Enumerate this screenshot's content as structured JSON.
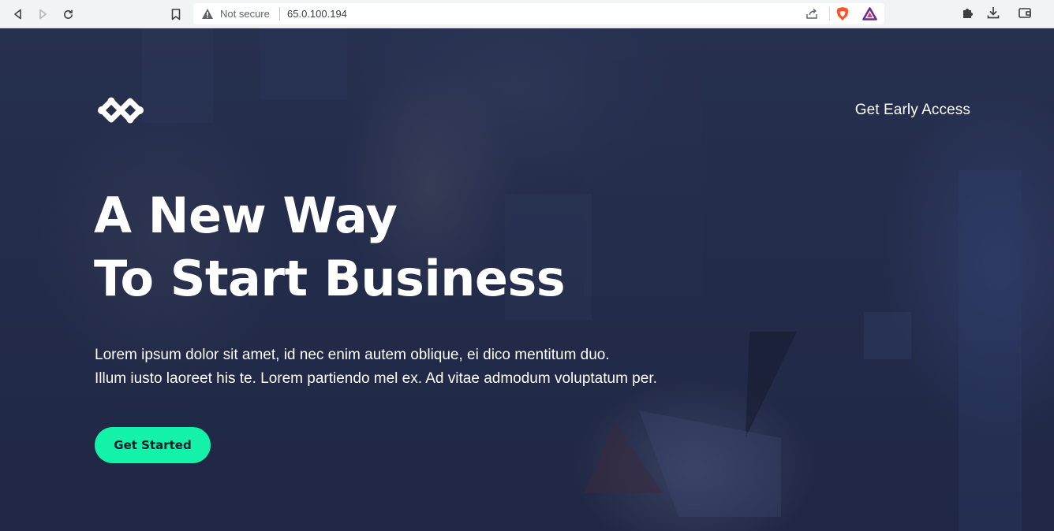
{
  "browser": {
    "security_label": "Not secure",
    "url": "65.0.100.194",
    "icons": [
      "back-icon",
      "forward-icon",
      "reload-icon",
      "bookmark-icon",
      "warning-icon",
      "share-icon",
      "brave-shield-icon",
      "brave-rewards-icon",
      "extensions-icon",
      "download-icon",
      "wallet-icon"
    ]
  },
  "header": {
    "logo": "logo-mark",
    "nav_cta": "Get Early Access"
  },
  "hero": {
    "headline": [
      "A New Way",
      "To Start Business"
    ],
    "lede": [
      "Lorem ipsum dolor sit amet, id nec enim autem oblique, ei dico mentitum duo.",
      "Illum iusto laoreet his te. Lorem partiendo mel ex. Ad vitae admodum voluptatum per."
    ],
    "cta_label": "Get Started"
  },
  "colors": {
    "overlay": "#222b49",
    "accent": "#13f2a8",
    "cta_text": "#0e1f2a",
    "chrome_bg": "#f1f3f4"
  }
}
